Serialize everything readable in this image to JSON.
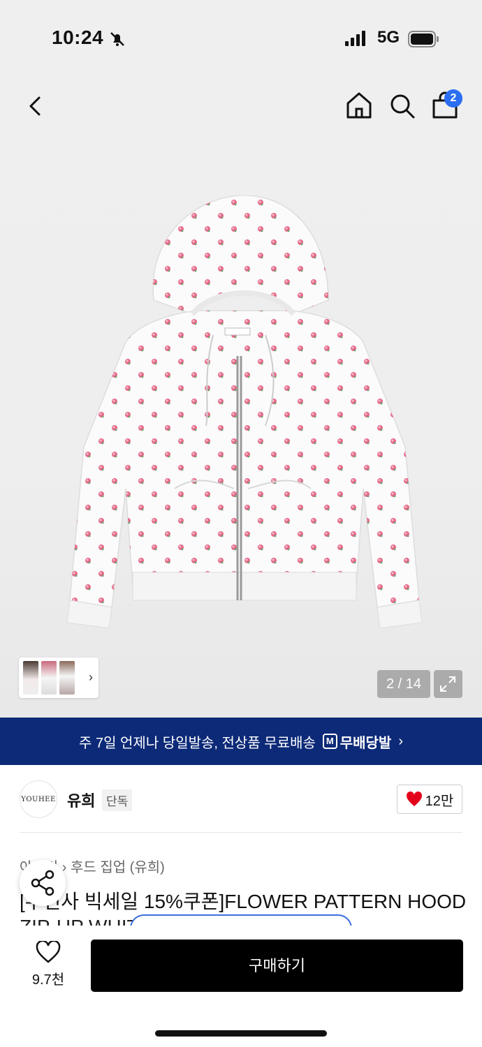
{
  "status": {
    "time": "10:24",
    "network": "5G"
  },
  "nav": {
    "cart_count": "2"
  },
  "gallery": {
    "counter": "2 / 14",
    "thumbnails": 3
  },
  "banner": {
    "text": "주 7일 언제나 당일발송, 전상품 무료배송",
    "brand": "무배당발",
    "chevron": "›"
  },
  "brand": {
    "logo_text": "YOUHEE",
    "name": "유희",
    "tag": "단독",
    "likes": "12만"
  },
  "breadcrumb": {
    "text": "아우터 › 후드 집업 (유희)"
  },
  "product": {
    "title": "[무신사 빅세일 15%쿠폰]FLOWER PATTERN HOOD",
    "title_line2": "ZIP-UP WHITE"
  },
  "bottom": {
    "wish_count": "9.7천",
    "buy_label": "구매하기"
  },
  "colors": {
    "banner_bg": "#0d2a78",
    "badge": "#2b6ef2",
    "heart": "#e3001b"
  }
}
